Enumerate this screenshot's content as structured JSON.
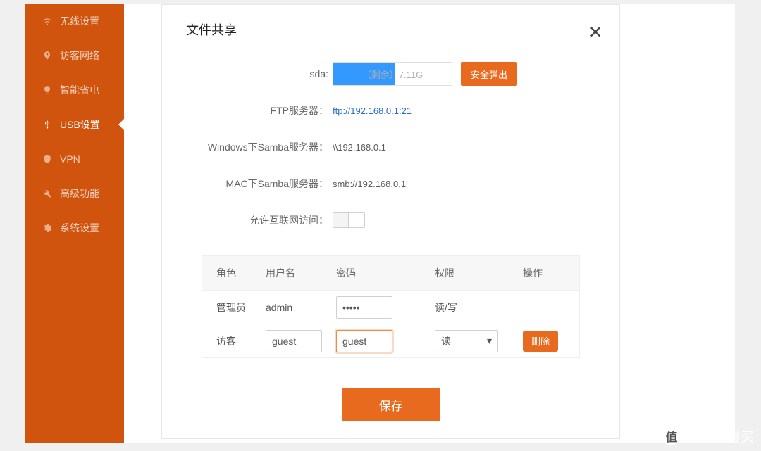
{
  "sidebar": {
    "items": [
      {
        "label": "无线设置",
        "icon": "wifi"
      },
      {
        "label": "访客网络",
        "icon": "location"
      },
      {
        "label": "智能省电",
        "icon": "bulb"
      },
      {
        "label": "USB设置",
        "icon": "usb",
        "active": true
      },
      {
        "label": "VPN",
        "icon": "vpn"
      },
      {
        "label": "高级功能",
        "icon": "wrench"
      },
      {
        "label": "系统设置",
        "icon": "gear"
      }
    ]
  },
  "modal": {
    "title": "文件共享",
    "close": "✕",
    "rows": {
      "sda_label": "sda:",
      "sda_remaining": "（剩余）7.11G",
      "eject": "安全弹出",
      "ftp_label": "FTP服务器：",
      "ftp_value": "ftp://192.168.0.1:21",
      "smb_win_label": "Windows下Samba服务器：",
      "smb_win_value": "\\\\192.168.0.1",
      "smb_mac_label": "MAC下Samba服务器：",
      "smb_mac_value": "smb://192.168.0.1",
      "internet_label": "允许互联网访问："
    },
    "table": {
      "headers": {
        "role": "角色",
        "user": "用户名",
        "pass": "密码",
        "perm": "权限",
        "action": "操作"
      },
      "rows": [
        {
          "role": "管理员",
          "user": "admin",
          "pass": "•••••",
          "perm": "读/写",
          "editable": false
        },
        {
          "role": "访客",
          "user": "guest",
          "pass": "guest",
          "perm": "读",
          "editable": true,
          "action": "删除"
        }
      ]
    },
    "save": "保存"
  },
  "watermark": {
    "badge": "值",
    "text": "什么值得买"
  },
  "colors": {
    "accent": "#e86a1e",
    "sidebar": "#d0540e",
    "link": "#2a6fc9"
  }
}
